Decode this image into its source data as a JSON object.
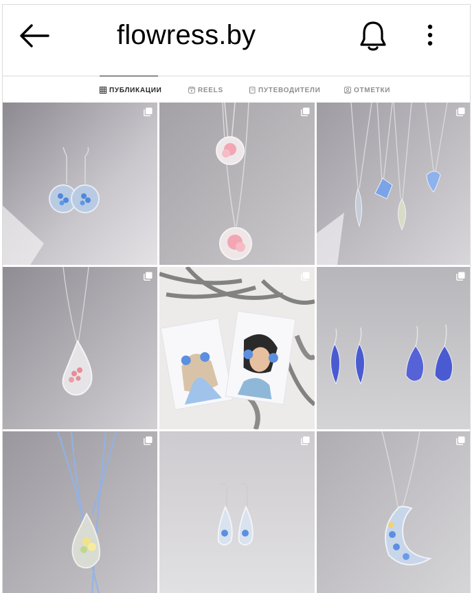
{
  "header": {
    "username": "flowress.by",
    "back_icon": "arrow-left-icon",
    "bell_icon": "bell-icon",
    "more_icon": "more-vertical-icon"
  },
  "tabs": [
    {
      "label": "ПУБЛИКАЦИИ",
      "icon": "grid-icon",
      "active": true
    },
    {
      "label": "REELS",
      "icon": "reels-icon",
      "active": false
    },
    {
      "label": "ПУТЕВОДИТЕЛИ",
      "icon": "guides-icon",
      "active": false
    },
    {
      "label": "ОТМЕТКИ",
      "icon": "tagged-icon",
      "active": false
    }
  ],
  "posts": [
    {
      "subject": "forget-me-not round earrings",
      "multi": true
    },
    {
      "subject": "pink flower round pendants",
      "multi": true
    },
    {
      "subject": "blue flower pendant collection",
      "multi": true
    },
    {
      "subject": "pink flower teardrop pendant",
      "multi": true
    },
    {
      "subject": "jewelry cards with earrings",
      "multi": true
    },
    {
      "subject": "blue petal earrings",
      "multi": true
    },
    {
      "subject": "yellow flower teardrop pendant",
      "multi": true
    },
    {
      "subject": "forget-me-not lever-back earrings",
      "multi": true
    },
    {
      "subject": "crescent moon forget-me-not pendant",
      "multi": true
    }
  ],
  "colors": {
    "border": "#dbdbdb",
    "text_active": "#262626",
    "text_inactive": "#8e8e8e",
    "flower_blue": "#5c8fe0",
    "flower_pink": "#f2a6b4"
  }
}
